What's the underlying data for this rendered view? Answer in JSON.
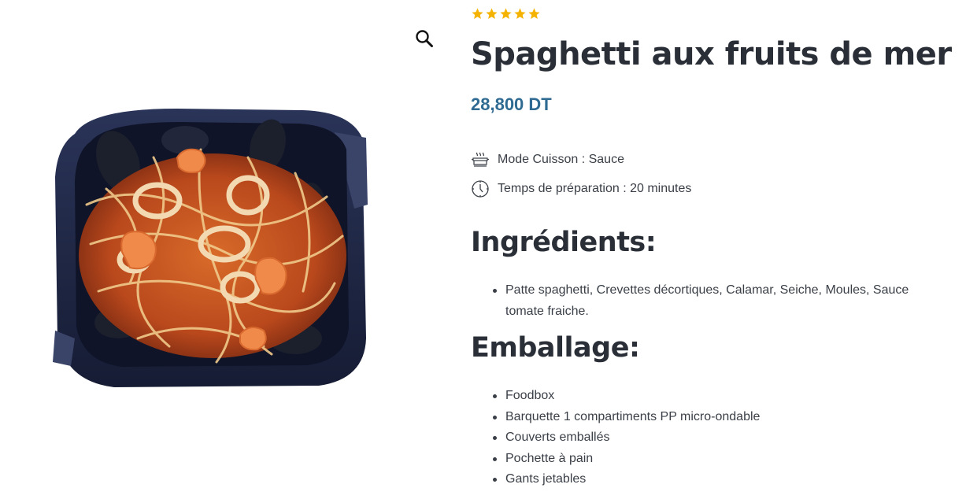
{
  "product": {
    "title": "Spaghetti aux fruits de mer",
    "price": "28,800 DT",
    "rating": {
      "value": 5,
      "max": 5,
      "star_color": "#f5b301"
    },
    "price_color": "#2e6a92"
  },
  "gallery": {
    "zoom_icon": "magnifier-icon",
    "image_alt": "Spaghetti aux fruits de mer"
  },
  "meta": {
    "cooking_mode": {
      "icon": "steaming-pot-icon",
      "text": "Mode Cuisson : Sauce"
    },
    "prep_time": {
      "icon": "clock-icon",
      "text": "Temps de préparation : 20 minutes"
    }
  },
  "ingredients": {
    "heading": "Ingrédients:",
    "items": [
      "Patte spaghetti, Crevettes décortiques, Calamar, Seiche, Moules, Sauce tomate fraiche."
    ]
  },
  "packaging": {
    "heading": "Emballage:",
    "items": [
      "Foodbox",
      "Barquette 1 compartiments PP micro-ondable",
      "Couverts emballés",
      "Pochette à pain",
      "Gants jetables"
    ]
  }
}
